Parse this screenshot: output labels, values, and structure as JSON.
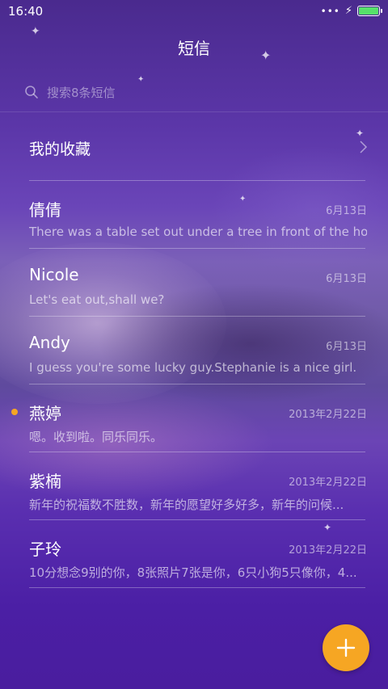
{
  "status_bar": {
    "time": "16:40",
    "signal_icon": "dots-icon",
    "charging_icon": "bolt-icon",
    "battery_icon": "battery-icon",
    "battery_color": "#56e06a"
  },
  "header": {
    "title": "短信"
  },
  "search": {
    "placeholder": "搜索8条短信",
    "icon": "search-icon"
  },
  "favorites": {
    "label": "我的收藏",
    "icon": "chevron-right-icon"
  },
  "conversations": [
    {
      "name": "倩倩",
      "date": "6月13日",
      "preview": "There was a table set out under a tree in front of the ho...",
      "unread": false
    },
    {
      "name": "Nicole",
      "date": "6月13日",
      "preview": "Let's eat out,shall we?",
      "unread": false
    },
    {
      "name": "Andy",
      "date": "6月13日",
      "preview": "I guess you're some lucky guy.Stephanie is a nice girl.",
      "unread": false
    },
    {
      "name": "燕婷",
      "date": "2013年2月22日",
      "preview": "嗯。收到啦。同乐同乐。",
      "unread": true
    },
    {
      "name": "紫楠",
      "date": "2013年2月22日",
      "preview": "新年的祝福数不胜数，新年的愿望好多好多，新年的问候...",
      "unread": false
    },
    {
      "name": "子玲",
      "date": "2013年2月22日",
      "preview": "10分想念9别的你，8张照片7张是你，6只小狗5只像你，4...",
      "unread": false
    }
  ],
  "fab": {
    "icon": "plus-icon",
    "color": "#f6a623"
  },
  "colors": {
    "unread_dot": "#f6a623",
    "accent": "#f6a623"
  }
}
